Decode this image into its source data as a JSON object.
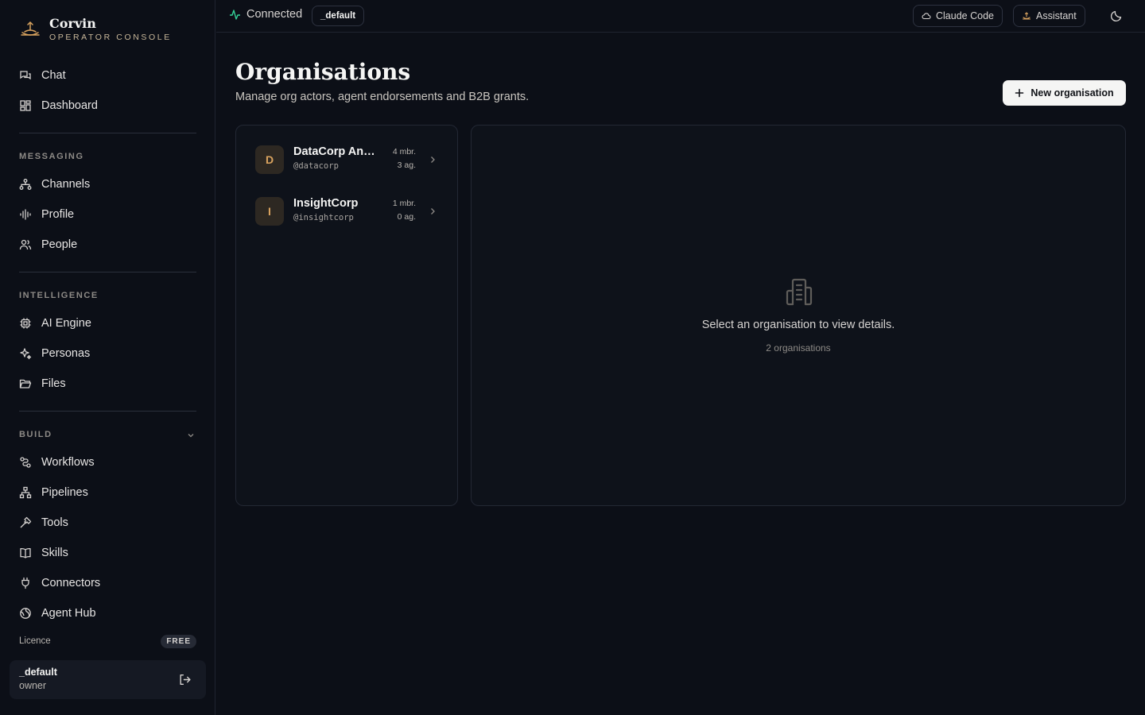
{
  "brand": {
    "name": "Corvin",
    "subtitle": "OPERATOR CONSOLE"
  },
  "nav_top": [
    {
      "label": "Chat",
      "icon": "chat-icon"
    },
    {
      "label": "Dashboard",
      "icon": "dashboard-icon"
    }
  ],
  "sections": {
    "messaging": {
      "label": "MESSAGING",
      "items": [
        {
          "label": "Channels",
          "icon": "channels-icon"
        },
        {
          "label": "Profile",
          "icon": "waveform-icon"
        },
        {
          "label": "People",
          "icon": "people-icon"
        }
      ]
    },
    "intelligence": {
      "label": "INTELLIGENCE",
      "items": [
        {
          "label": "AI Engine",
          "icon": "cpu-icon"
        },
        {
          "label": "Personas",
          "icon": "sparkles-icon"
        },
        {
          "label": "Files",
          "icon": "folder-icon"
        }
      ]
    },
    "build": {
      "label": "BUILD",
      "items": [
        {
          "label": "Workflows",
          "icon": "workflow-icon"
        },
        {
          "label": "Pipelines",
          "icon": "pipeline-icon"
        },
        {
          "label": "Tools",
          "icon": "hammer-icon"
        },
        {
          "label": "Skills",
          "icon": "book-icon"
        },
        {
          "label": "Connectors",
          "icon": "plug-icon"
        },
        {
          "label": "Agent Hub",
          "icon": "globe-icon"
        }
      ]
    }
  },
  "licence": {
    "label": "Licence",
    "tier": "FREE"
  },
  "user": {
    "name": "_default",
    "role": "owner"
  },
  "topbar": {
    "status": "Connected",
    "workspace": "_default",
    "claude_code_label": "Claude Code",
    "assistant_label": "Assistant"
  },
  "page": {
    "title": "Organisations",
    "subtitle": "Manage org actors, agent endorsements and B2B grants.",
    "new_button": "New organisation"
  },
  "orgs": [
    {
      "initial": "D",
      "name": "DataCorp Analytics",
      "handle": "@datacorp",
      "members": "4 mbr.",
      "agents": "3 ag."
    },
    {
      "initial": "I",
      "name": "InsightCorp",
      "handle": "@insightcorp",
      "members": "1 mbr.",
      "agents": "0 ag."
    }
  ],
  "detail": {
    "empty_message": "Select an organisation to view details.",
    "count": "2 organisations"
  },
  "colors": {
    "accent": "#d9a35f",
    "connected": "#34d399",
    "background": "#0c0f17"
  }
}
